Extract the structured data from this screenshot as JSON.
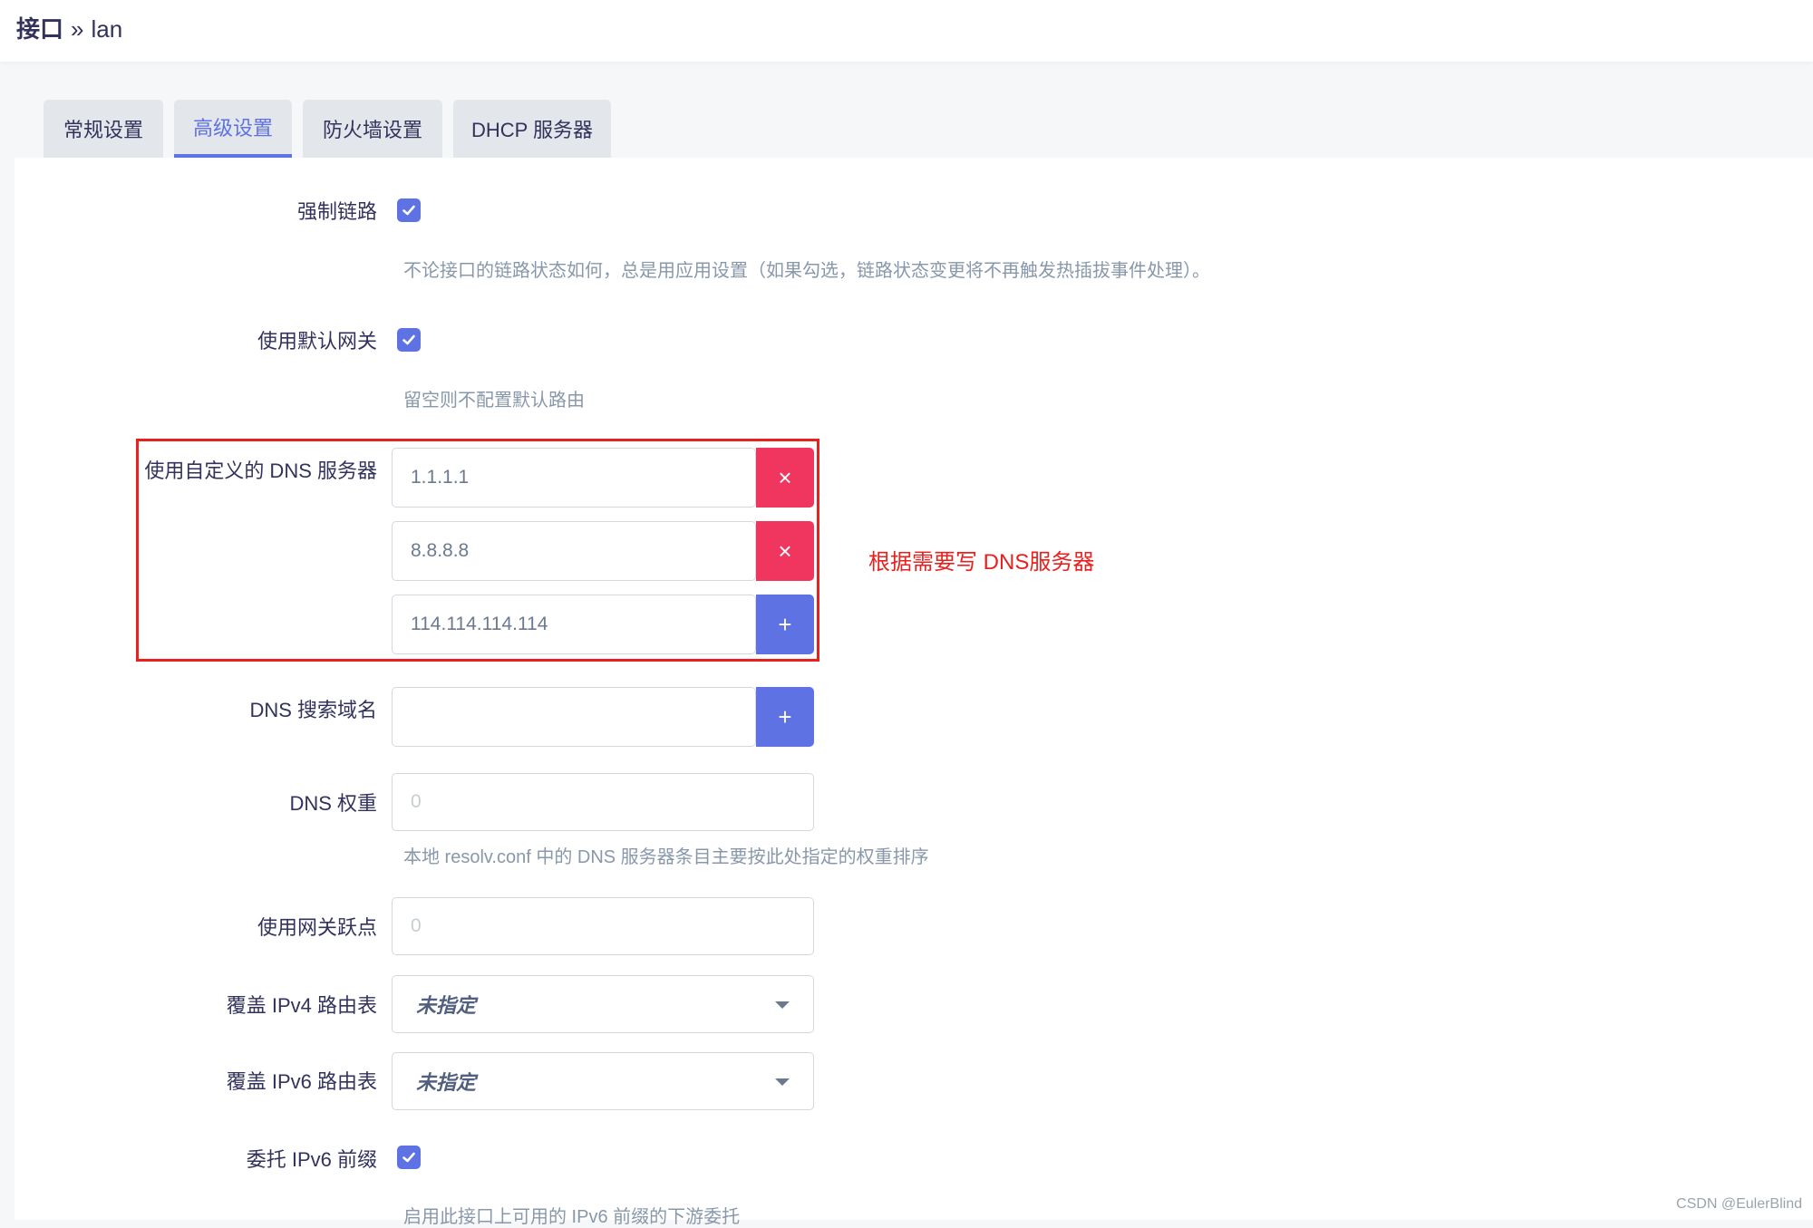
{
  "breadcrumb": {
    "root": "接口",
    "separator": "»",
    "current": "lan"
  },
  "tabs": [
    {
      "label": "常规设置",
      "active": false
    },
    {
      "label": "高级设置",
      "active": true
    },
    {
      "label": "防火墙设置",
      "active": false
    },
    {
      "label": "DHCP 服务器",
      "active": false
    }
  ],
  "form": {
    "force_link": {
      "label": "强制链路",
      "checked": true,
      "hint": "不论接口的链路状态如何，总是用应用设置（如果勾选，链路状态变更将不再触发热插拔事件处理）。"
    },
    "default_gateway": {
      "label": "使用默认网关",
      "checked": true,
      "hint": "留空则不配置默认路由"
    },
    "custom_dns": {
      "label": "使用自定义的 DNS 服务器",
      "entries": [
        "1.1.1.1",
        "8.8.8.8",
        "114.114.114.114"
      ]
    },
    "dns_search": {
      "label": "DNS 搜索域名",
      "value": ""
    },
    "dns_weight": {
      "label": "DNS 权重",
      "placeholder": "0",
      "hint": "本地 resolv.conf 中的 DNS 服务器条目主要按此处指定的权重排序"
    },
    "gateway_metric": {
      "label": "使用网关跃点",
      "placeholder": "0"
    },
    "ipv4_table": {
      "label": "覆盖 IPv4 路由表",
      "selected": "未指定"
    },
    "ipv6_table": {
      "label": "覆盖 IPv6 路由表",
      "selected": "未指定"
    },
    "delegate_ipv6": {
      "label": "委托 IPv6 前缀",
      "checked": true,
      "hint": "启用此接口上可用的 IPv6 前缀的下游委托"
    }
  },
  "buttons": {
    "remove_glyph": "×",
    "add_glyph": "+"
  },
  "annotation": "根据需要写 DNS服务器",
  "watermark": "CSDN @EulerBlind",
  "colors": {
    "accent": "#5e72e4",
    "danger": "#f0355e",
    "annotation": "#e8211f"
  }
}
